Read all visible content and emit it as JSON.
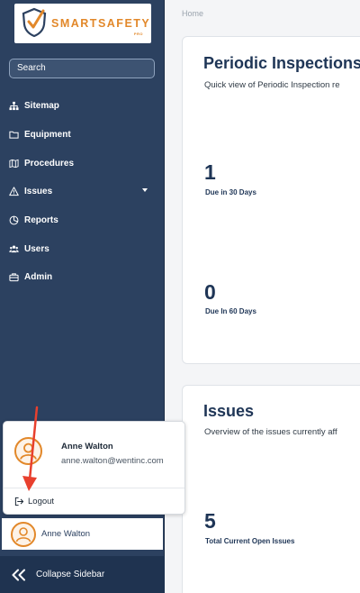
{
  "logo": {
    "brand": "SMARTSAFETY",
    "suffix": "PRO"
  },
  "search": {
    "label": "Search"
  },
  "nav": {
    "items": [
      {
        "label": "Sitemap",
        "icon": "sitemap-icon"
      },
      {
        "label": "Equipment",
        "icon": "folder-icon"
      },
      {
        "label": "Procedures",
        "icon": "map-icon"
      },
      {
        "label": "Issues",
        "icon": "warning-icon"
      },
      {
        "label": "Reports",
        "icon": "chart-icon"
      },
      {
        "label": "Users",
        "icon": "users-icon"
      },
      {
        "label": "Admin",
        "icon": "briefcase-icon"
      }
    ]
  },
  "breadcrumb": "Home",
  "periodic": {
    "title": "Periodic Inspections",
    "subtitle": "Quick view of Periodic Inspection re",
    "stat1_value": "1",
    "stat1_label": "Due in 30 Days",
    "stat2_value": "0",
    "stat2_label": "Due In 60 Days"
  },
  "issues": {
    "title": "Issues",
    "subtitle": "Overview of the issues currently aff",
    "stat_value": "5",
    "stat_label": "Total Current Open Issues"
  },
  "user_menu": {
    "name": "Anne Walton",
    "email": "anne.walton@wentinc.com",
    "logout_label": "Logout"
  },
  "sidebar_user": {
    "name": "Anne Walton"
  },
  "collapse": {
    "label": "Collapse Sidebar"
  },
  "colors": {
    "sidebar": "#2c4160",
    "accent": "#e2882a",
    "annotation_arrow": "#e8402e"
  }
}
